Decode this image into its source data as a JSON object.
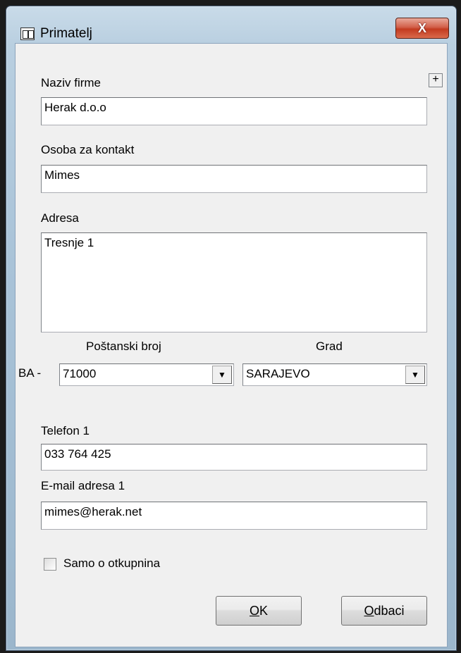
{
  "window": {
    "title": "Primatelj",
    "close_glyph": "X"
  },
  "form": {
    "company_name": {
      "label": "Naziv firme",
      "value": "Herak d.o.o"
    },
    "contact": {
      "label": "Osoba za kontakt",
      "value": "Mimes"
    },
    "address": {
      "label": "Adresa",
      "value": "Tresnje 1"
    },
    "postal": {
      "label": "Poštanski broj",
      "prefix": "BA -",
      "value": "71000"
    },
    "city": {
      "label": "Grad",
      "value": "SARAJEVO"
    },
    "phone": {
      "label": "Telefon 1",
      "value": "033 764 425"
    },
    "email": {
      "label": "E-mail adresa 1",
      "value": "mimes@herak.net"
    },
    "cod_checkbox": {
      "label": "Samo o otkupnina",
      "checked": false
    },
    "expand_glyph": "+"
  },
  "buttons": {
    "ok": {
      "mnemonic": "O",
      "rest": "K"
    },
    "cancel": {
      "mnemonic": "O",
      "rest": "dbaci"
    }
  },
  "icons": {
    "title_icon": "address-book-icon",
    "close_icon": "close-icon",
    "dropdown_icon": "chevron-down-icon",
    "expand_icon": "plus-icon"
  }
}
